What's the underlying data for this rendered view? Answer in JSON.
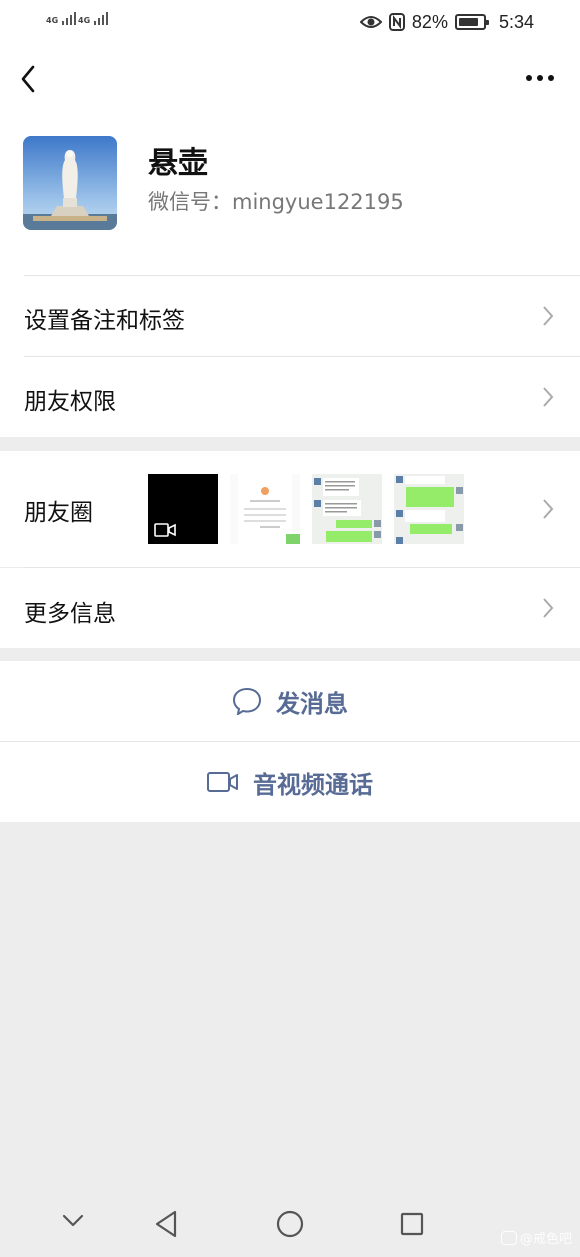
{
  "status_bar": {
    "signal1": "4G",
    "signal2": "4G",
    "battery_percent": "82%",
    "battery_level": 0.82,
    "time": "5:34"
  },
  "header": {
    "back_icon": "chevron-left-icon",
    "more_icon": "more-dots-icon"
  },
  "profile": {
    "nickname": "悬壶",
    "wechat_id": "微信号：mingyue122195"
  },
  "menu": {
    "remarks_tags": "设置备注和标签",
    "friend_permissions": "朋友权限",
    "moments": "朋友圈",
    "more_info": "更多信息"
  },
  "actions": {
    "send_message": "发消息",
    "video_call": "音视频通话"
  },
  "bottom_nav": {
    "icons": [
      "chevron-down-icon",
      "back-triangle-icon",
      "home-circle-icon",
      "recents-square-icon"
    ]
  },
  "watermark": "@戒色吧",
  "colors": {
    "accent": "#576b95",
    "background": "#ededed",
    "chat_green": "#95ec69"
  }
}
